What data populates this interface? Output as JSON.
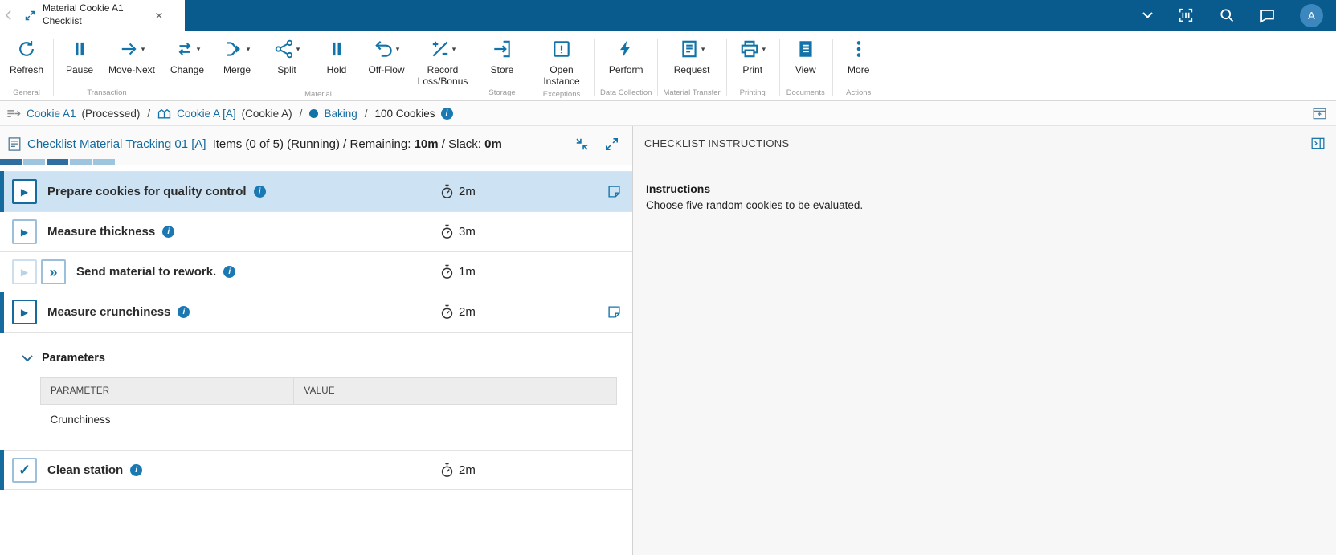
{
  "colors": {
    "topbar": "#095a8d",
    "accent": "#1273a8",
    "link": "#156a9e",
    "selected_row": "#cde2f2"
  },
  "topbar": {
    "tab_title": "Material Cookie A1 Checklist",
    "avatar_initial": "A"
  },
  "ribbon": {
    "groups": [
      {
        "label": "General",
        "buttons": [
          {
            "label": "Refresh",
            "icon": "refresh-icon",
            "dropdown": false
          }
        ]
      },
      {
        "label": "Transaction",
        "buttons": [
          {
            "label": "Pause",
            "icon": "pause-icon",
            "dropdown": false
          },
          {
            "label": "Move-Next",
            "icon": "move-next-icon",
            "dropdown": true
          }
        ]
      },
      {
        "label": "Material",
        "buttons": [
          {
            "label": "Change",
            "icon": "change-icon",
            "dropdown": true
          },
          {
            "label": "Merge",
            "icon": "merge-icon",
            "dropdown": true
          },
          {
            "label": "Split",
            "icon": "split-icon",
            "dropdown": true
          },
          {
            "label": "Hold",
            "icon": "hold-icon",
            "dropdown": false
          },
          {
            "label": "Off-Flow",
            "icon": "off-flow-icon",
            "dropdown": true
          },
          {
            "label": "Record Loss/Bonus",
            "icon": "record-loss-bonus-icon",
            "dropdown": true
          }
        ]
      },
      {
        "label": "Storage",
        "buttons": [
          {
            "label": "Store",
            "icon": "store-icon",
            "dropdown": false
          }
        ]
      },
      {
        "label": "Exceptions",
        "buttons": [
          {
            "label": "Open Instance",
            "icon": "open-instance-icon",
            "dropdown": false
          }
        ]
      },
      {
        "label": "Data Collection",
        "buttons": [
          {
            "label": "Perform",
            "icon": "perform-icon",
            "dropdown": false
          }
        ]
      },
      {
        "label": "Material Transfer",
        "buttons": [
          {
            "label": "Request",
            "icon": "request-icon",
            "dropdown": true
          }
        ]
      },
      {
        "label": "Printing",
        "buttons": [
          {
            "label": "Print",
            "icon": "print-icon",
            "dropdown": true
          }
        ]
      },
      {
        "label": "Documents",
        "buttons": [
          {
            "label": "View",
            "icon": "view-icon",
            "dropdown": false
          }
        ]
      },
      {
        "label": "Actions",
        "buttons": [
          {
            "label": "More",
            "icon": "more-icon",
            "dropdown": false
          }
        ]
      }
    ]
  },
  "breadcrumb": {
    "separator": "/",
    "segments": [
      {
        "link": "Cookie A1",
        "note": "(Processed)",
        "icon": "material-icon"
      },
      {
        "link": "Cookie A [A]",
        "note": "(Cookie A)",
        "icon": "resource-icon"
      },
      {
        "link": "Baking",
        "note": "",
        "icon": "status-dot"
      },
      {
        "link": "100 Cookies",
        "note": "",
        "icon": "info-icon"
      }
    ]
  },
  "checklist": {
    "title": "Checklist Material Tracking 01 [A]",
    "items_count": "Items (0 of 5)",
    "status": "(Running)",
    "remaining_label": "/ Remaining:",
    "remaining_value": "10m",
    "slack_label": "/ Slack:",
    "slack_value": "0m",
    "progress_states": [
      "dark",
      "light",
      "dark",
      "light",
      "light"
    ],
    "items": [
      {
        "label": "Prepare cookies for quality control",
        "duration": "2m",
        "selected": true,
        "has_note": true,
        "action": "play"
      },
      {
        "label": "Measure thickness",
        "duration": "3m",
        "selected": false,
        "has_note": false,
        "action": "play"
      },
      {
        "label": "Send material to rework.",
        "duration": "1m",
        "selected": false,
        "has_note": false,
        "action": "play-skip"
      },
      {
        "label": "Measure crunchiness",
        "duration": "2m",
        "selected": false,
        "has_note": true,
        "action": "play"
      },
      {
        "label": "Clean station",
        "duration": "2m",
        "selected": false,
        "has_note": false,
        "action": "checkbox-checked"
      }
    ],
    "parameters": {
      "title": "Parameters",
      "columns": {
        "parameter": "PARAMETER",
        "value": "VALUE"
      },
      "rows": [
        {
          "parameter": "Crunchiness",
          "value": ""
        }
      ]
    }
  },
  "instructions": {
    "header": "CHECKLIST INSTRUCTIONS",
    "title": "Instructions",
    "body": "Choose five random cookies to be evaluated."
  }
}
